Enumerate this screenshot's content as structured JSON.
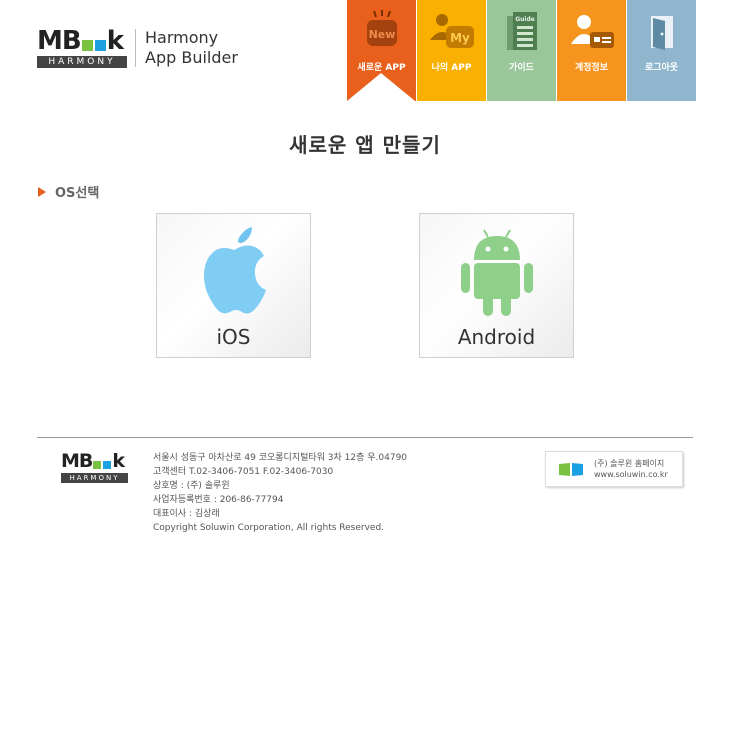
{
  "header": {
    "logo": {
      "mark": "MB",
      "mark_tail": "k",
      "sub": "HARMONY",
      "line1": "Harmony",
      "line2": "App Builder"
    },
    "nav": [
      {
        "label": "새로운 APP",
        "icon_text": "New",
        "icon": "new-app-icon",
        "color": "#e8601c",
        "active": true
      },
      {
        "label": "나의 APP",
        "icon_text": "My",
        "icon": "my-app-icon",
        "color": "#f9b000"
      },
      {
        "label": "가이드",
        "icon_text": "Guide",
        "icon": "guide-icon",
        "color": "#99c79a"
      },
      {
        "label": "계정정보",
        "icon": "account-icon",
        "color": "#f7941d"
      },
      {
        "label": "로그아웃",
        "icon": "logout-icon",
        "color": "#8fb6cc"
      }
    ]
  },
  "main": {
    "title": "새로운 앱 만들기",
    "section_label": "OS선택",
    "os_options": [
      {
        "label": "iOS",
        "icon": "apple-icon"
      },
      {
        "label": "Android",
        "icon": "android-icon"
      }
    ]
  },
  "footer": {
    "logo": {
      "mark": "MB",
      "mark_tail": "k",
      "sub": "HARMONY"
    },
    "lines": [
      "서울시 성동구 아차산로 49 코오롱디지털타워 3차 12층 우.04790",
      "고객센터 T.02-3406-7051 F.02-3406-7030",
      "상호명 : (주) 솔루윈",
      "사업자등록번호 : 206-86-77794",
      "대표이사 : 김상래",
      "Copyright Soluwin Corporation, All rights Reserved."
    ],
    "badge": {
      "line1": "(주) 솔루윈 홈페이지",
      "line2": "www.soluwin.co.kr"
    }
  },
  "colors": {
    "accent": "#e8601c",
    "logo_green": "#7cc242",
    "logo_blue": "#1ba0e1"
  }
}
